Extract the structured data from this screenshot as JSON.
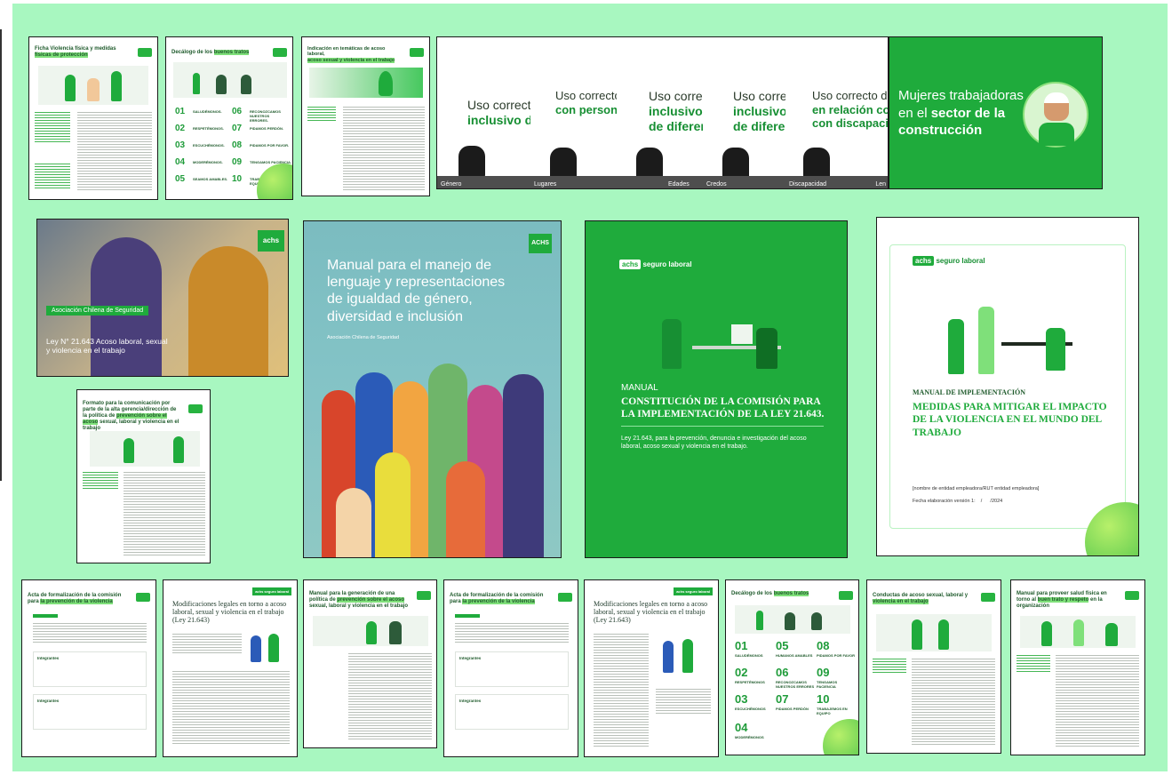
{
  "colors": {
    "background": "#a8f7c0",
    "brand_green": "#1fab3c",
    "highlight": "#7fe07a",
    "dark_text": "#1e5a2b"
  },
  "row1": {
    "doc1_title_a": "Ficha Violencia física y medidas",
    "doc1_title_hl": "físicas de protección",
    "doc2_title_a": "Decálogo de los",
    "doc2_title_hl": "buenos tratos",
    "doc2_nums": [
      "01",
      "02",
      "03",
      "04",
      "05",
      "06",
      "07",
      "08",
      "09",
      "10"
    ],
    "doc2_labels": [
      "SALUDÉMONOS.",
      "RESPETÉMONOS.",
      "ESCUCHÉMONOS.",
      "MODERÉMONOS.",
      "SEAMOS AMABLES.",
      "RECONOZCAMOS NUESTROS ERRORES.",
      "PIDAMOS PERDÓN.",
      "PIDAMOS POR FAVOR.",
      "TENGAMOS PACIENCIA.",
      "TRABAJEMOS EN EQUIPO."
    ],
    "doc3_title_a": "Indicación en temáticas de acoso laboral,",
    "doc3_title_hl": "acoso sexual y violencia en el trabajo",
    "video1_text_a": "Uso correcto",
    "video1_text_b": "inclusivo de",
    "video1_bar": "Género",
    "video2_text_a": "Uso correcto c",
    "video2_text_b": "con personas",
    "video2_bar": "Lugares",
    "video3_text_a": "Uso correcto",
    "video3_text_b": "inclusivo d",
    "video3_text_c": "de diferen",
    "video3_bar": "Edades",
    "video4_text_a": "Uso corre",
    "video4_text_b": "inclusivo",
    "video4_text_c": "de diferer",
    "video4_bar": "Credos",
    "video5_text_a": "Uso correcto del",
    "video5_text_b": "en relación con",
    "video5_text_c": "con discapacida",
    "video5_bar": "Discapacidad",
    "video5_bar_tail": "Len",
    "mujeres_line1": "Mujeres trabajadoras",
    "mujeres_line2_a": "en el",
    "mujeres_line2_b": "sector de la",
    "mujeres_line3": "construcción"
  },
  "row2": {
    "photo_badge": "achs",
    "photo_org": "Asociación Chilena de Seguridad",
    "photo_law": "Ley N° 21.643 Acoso laboral, sexual y violencia en el trabajo",
    "formato_title_a": "Formato para la comunicación por parte de la alta gerencia/dirección de la política de",
    "formato_title_hl": "prevención sobre el acoso",
    "formato_title_b": "sexual, laboral y violencia en el trabajo",
    "manual_logo": "ACHS",
    "manual_title": "Manual para el manejo de lenguaje y representaciones de igualdad de género, diversidad e inclusión",
    "manual_org": "Asociación Chilena de Seguridad",
    "comision_logo_a": "achs",
    "comision_logo_b": "seguro laboral",
    "comision_kicker": "MANUAL",
    "comision_title": "CONSTITUCIÓN DE LA COMISIÓN PARA LA IMPLEMENTACIÓN DE LA LEY 21.643.",
    "comision_sub": "Ley 21.643, para la prevención, denuncia e investigación del acoso laboral, acoso sexual y violencia en el trabajo.",
    "impl_logo_a": "achs",
    "impl_logo_b": "seguro laboral",
    "impl_kicker": "MANUAL DE IMPLEMENTACIÓN",
    "impl_title": "MEDIDAS PARA MITIGAR EL IMPACTO DE LA VIOLENCIA EN EL MUNDO DEL TRABAJO",
    "impl_field": "[nombre de entidad empleadora/RUT entidad empleadora]",
    "impl_date": "Fecha elaboración versión 1:    /      /2024"
  },
  "row3": {
    "acta1_title_a": "Acta de formalización de la comisión",
    "acta1_title_b": "para",
    "acta1_title_hl": "la prevención de la violencia",
    "acta1_sec1": "Integrantes",
    "acta1_sec2": "Integrantes",
    "mod1_logo": "achs seguro laboral",
    "mod1_title": "Modificaciones legales en torno a acoso laboral, sexual y violencia en el trabajo (Ley 21.643)",
    "politica_title_a": "Manual para la generación de una política de",
    "politica_title_hl": "prevención sobre el acoso",
    "politica_title_b": "sexual, laboral y violencia en el trabajo",
    "acta2_title_a": "Acta de formalización de la comisión",
    "acta2_title_b": "para",
    "acta2_title_hl": "la prevención de la violencia",
    "acta2_sec1": "Integrantes",
    "acta2_sec2": "Integrantes",
    "mod2_logo": "achs seguro laboral",
    "mod2_title": "Modificaciones legales en torno a acoso laboral, sexual y violencia en el trabajo (Ley 21.643)",
    "dec2_title_a": "Decálogo de los",
    "dec2_title_hl": "buenos tratos",
    "dec2_nums": [
      "01",
      "05",
      "08",
      "02",
      "06",
      "09",
      "03",
      "07",
      "10",
      "04"
    ],
    "dec2_labels": [
      "SALUDÉMONOS",
      "HUMANOS AMABLES",
      "PIDAMOS POR FAVOR",
      "RESPETÉMONOS",
      "RECONOZCAMOS NUESTROS ERRORES",
      "TENGAMOS PACIENCIA",
      "ESCUCHÉMONOS",
      "PIDAMOS PERDÓN",
      "TRABAJEMOS EN EQUIPO",
      "MODERÉMONOS"
    ],
    "conductas_title_a": "Conductas de acoso sexual, laboral y",
    "conductas_title_hl": "violencia en el trabajo",
    "salud_title_a": "Manual para proveer salud física en torno al",
    "salud_title_hl": "buen trato y respeto",
    "salud_title_b": "en la organización"
  }
}
